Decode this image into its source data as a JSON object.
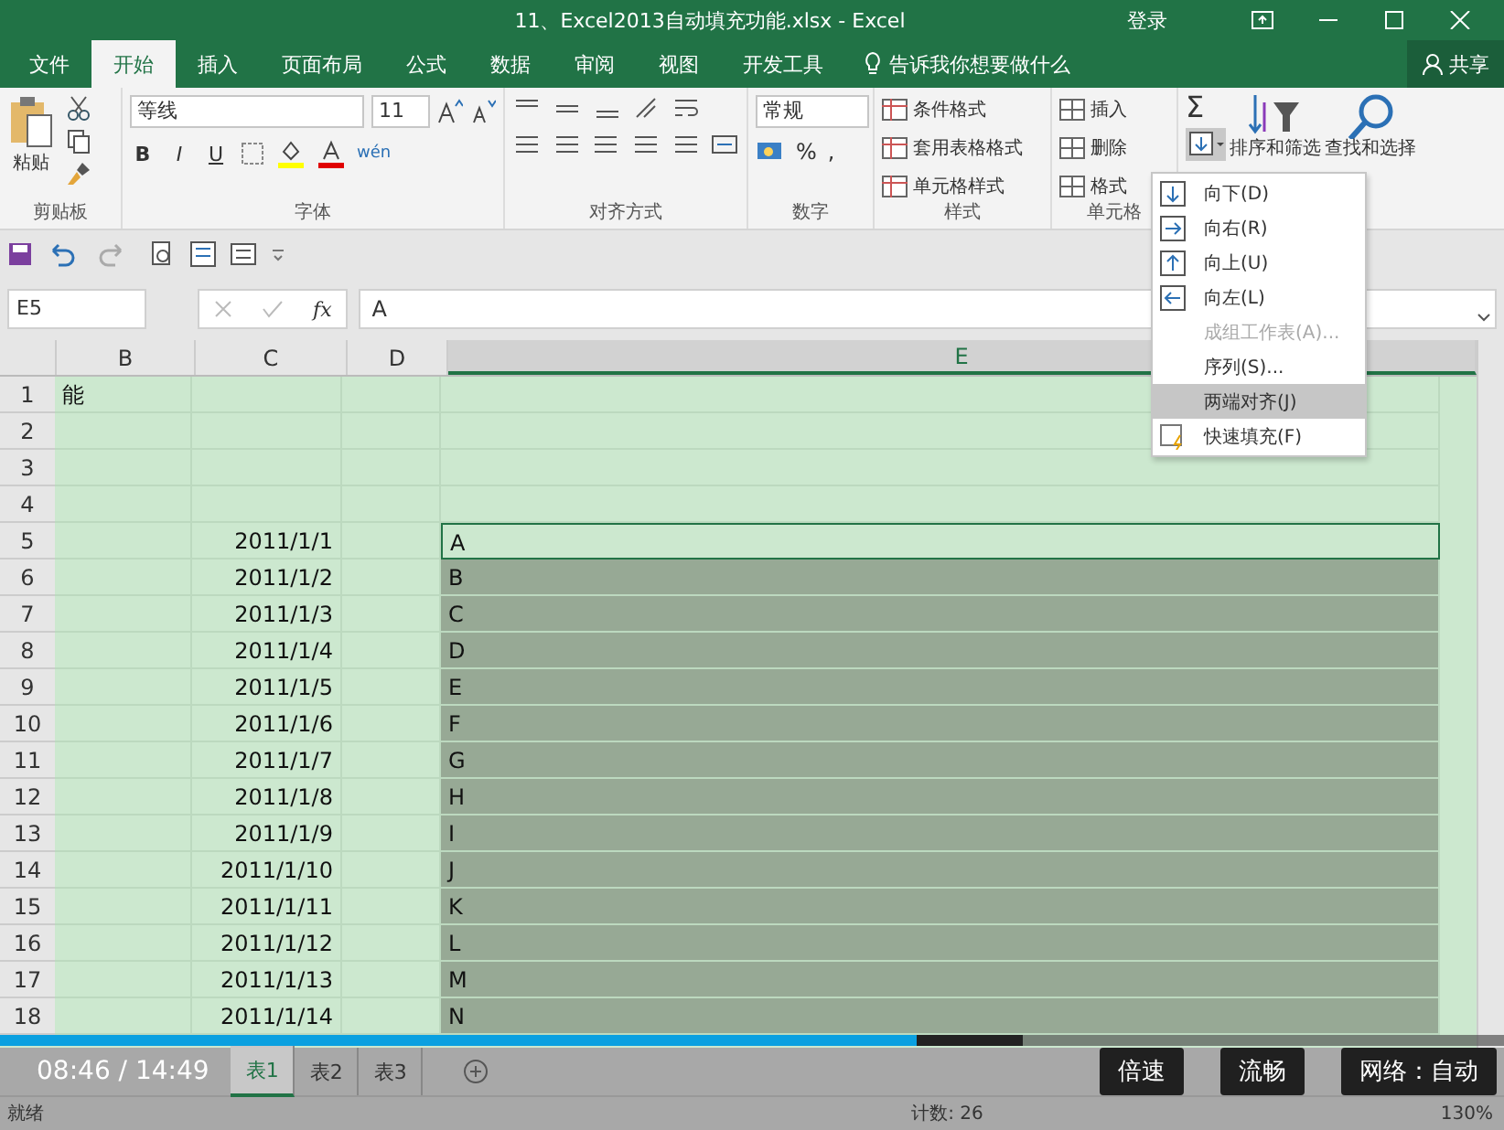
{
  "window": {
    "title": "11、Excel2013自动填充功能.xlsx  -  Excel",
    "sign_in": "登录"
  },
  "tabs": [
    {
      "label": "文件",
      "selected": false
    },
    {
      "label": "开始",
      "selected": true
    },
    {
      "label": "插入",
      "selected": false
    },
    {
      "label": "页面布局",
      "selected": false
    },
    {
      "label": "公式",
      "selected": false
    },
    {
      "label": "数据",
      "selected": false
    },
    {
      "label": "审阅",
      "selected": false
    },
    {
      "label": "视图",
      "selected": false
    },
    {
      "label": "开发工具",
      "selected": false
    }
  ],
  "tell_me": "告诉我你想要做什么",
  "share": "共享",
  "ribbon": {
    "clipboard": {
      "paste": "粘贴",
      "label": "剪贴板"
    },
    "font": {
      "name": "等线",
      "size": "11",
      "label": "字体",
      "phonetic": "wén",
      "bold": "B",
      "italic": "I",
      "underline": "U"
    },
    "alignment": {
      "label": "对齐方式"
    },
    "number": {
      "format": "常规",
      "percent": "%",
      "comma": ",",
      "label": "数字"
    },
    "styles": {
      "items": [
        "条件格式",
        "套用表格格式",
        "单元格样式"
      ],
      "label": "样式"
    },
    "cells": {
      "items": [
        "插入",
        "删除",
        "格式"
      ],
      "label": "单元格"
    },
    "editing": {
      "sum": "Σ",
      "sort": "排序和筛选",
      "find": "查找和选择"
    }
  },
  "fill_menu": [
    {
      "label": "向下(D)",
      "kind": "down",
      "disabled": false,
      "selected": false
    },
    {
      "label": "向右(R)",
      "kind": "right",
      "disabled": false,
      "selected": false
    },
    {
      "label": "向上(U)",
      "kind": "up",
      "disabled": false,
      "selected": false
    },
    {
      "label": "向左(L)",
      "kind": "left",
      "disabled": false,
      "selected": false
    },
    {
      "label": "成组工作表(A)...",
      "kind": "plain",
      "disabled": true,
      "selected": false
    },
    {
      "label": "序列(S)...",
      "kind": "plain",
      "disabled": false,
      "selected": false
    },
    {
      "label": "两端对齐(J)",
      "kind": "plain",
      "disabled": false,
      "selected": true
    },
    {
      "label": "快速填充(F)",
      "kind": "flash",
      "disabled": false,
      "selected": false
    }
  ],
  "formula_bar": {
    "name_box": "E5",
    "fx": "fx",
    "value": "A"
  },
  "columns": [
    {
      "label": "B",
      "selected": false
    },
    {
      "label": "C",
      "selected": false
    },
    {
      "label": "D",
      "selected": false
    },
    {
      "label": "E",
      "selected": true
    }
  ],
  "rows": [
    {
      "number": "1",
      "b": "能",
      "c": "",
      "e": "",
      "selected": false
    },
    {
      "number": "2",
      "b": "",
      "c": "",
      "e": "",
      "selected": false
    },
    {
      "number": "3",
      "b": "",
      "c": "",
      "e": "",
      "selected": false
    },
    {
      "number": "4",
      "b": "",
      "c": "",
      "e": "",
      "selected": false
    },
    {
      "number": "5",
      "b": "",
      "c": "2011/1/1",
      "e": "A",
      "selected": false
    },
    {
      "number": "6",
      "b": "",
      "c": "2011/1/2",
      "e": "B",
      "selected": true
    },
    {
      "number": "7",
      "b": "",
      "c": "2011/1/3",
      "e": "C",
      "selected": true
    },
    {
      "number": "8",
      "b": "",
      "c": "2011/1/4",
      "e": "D",
      "selected": true
    },
    {
      "number": "9",
      "b": "",
      "c": "2011/1/5",
      "e": "E",
      "selected": true
    },
    {
      "number": "10",
      "b": "",
      "c": "2011/1/6",
      "e": "F",
      "selected": true
    },
    {
      "number": "11",
      "b": "",
      "c": "2011/1/7",
      "e": "G",
      "selected": true
    },
    {
      "number": "12",
      "b": "",
      "c": "2011/1/8",
      "e": "H",
      "selected": true
    },
    {
      "number": "13",
      "b": "",
      "c": "2011/1/9",
      "e": "I",
      "selected": true
    },
    {
      "number": "14",
      "b": "",
      "c": "2011/1/10",
      "e": "J",
      "selected": true
    },
    {
      "number": "15",
      "b": "",
      "c": "2011/1/11",
      "e": "K",
      "selected": true
    },
    {
      "number": "16",
      "b": "",
      "c": "2011/1/12",
      "e": "L",
      "selected": true
    },
    {
      "number": "17",
      "b": "",
      "c": "2011/1/13",
      "e": "M",
      "selected": true
    },
    {
      "number": "18",
      "b": "",
      "c": "2011/1/14",
      "e": "N",
      "selected": true
    }
  ],
  "sheets": [
    {
      "label": "表1",
      "selected": true
    },
    {
      "label": "表2",
      "selected": false
    },
    {
      "label": "表3",
      "selected": false
    }
  ],
  "status_bar": {
    "ready": "就绪",
    "count": "计数: 26",
    "zoom": "130%"
  },
  "player": {
    "time": "08:46 / 14:49",
    "level": 0.61,
    "buttons": [
      "倍速",
      "流畅",
      "网络：自动"
    ]
  }
}
